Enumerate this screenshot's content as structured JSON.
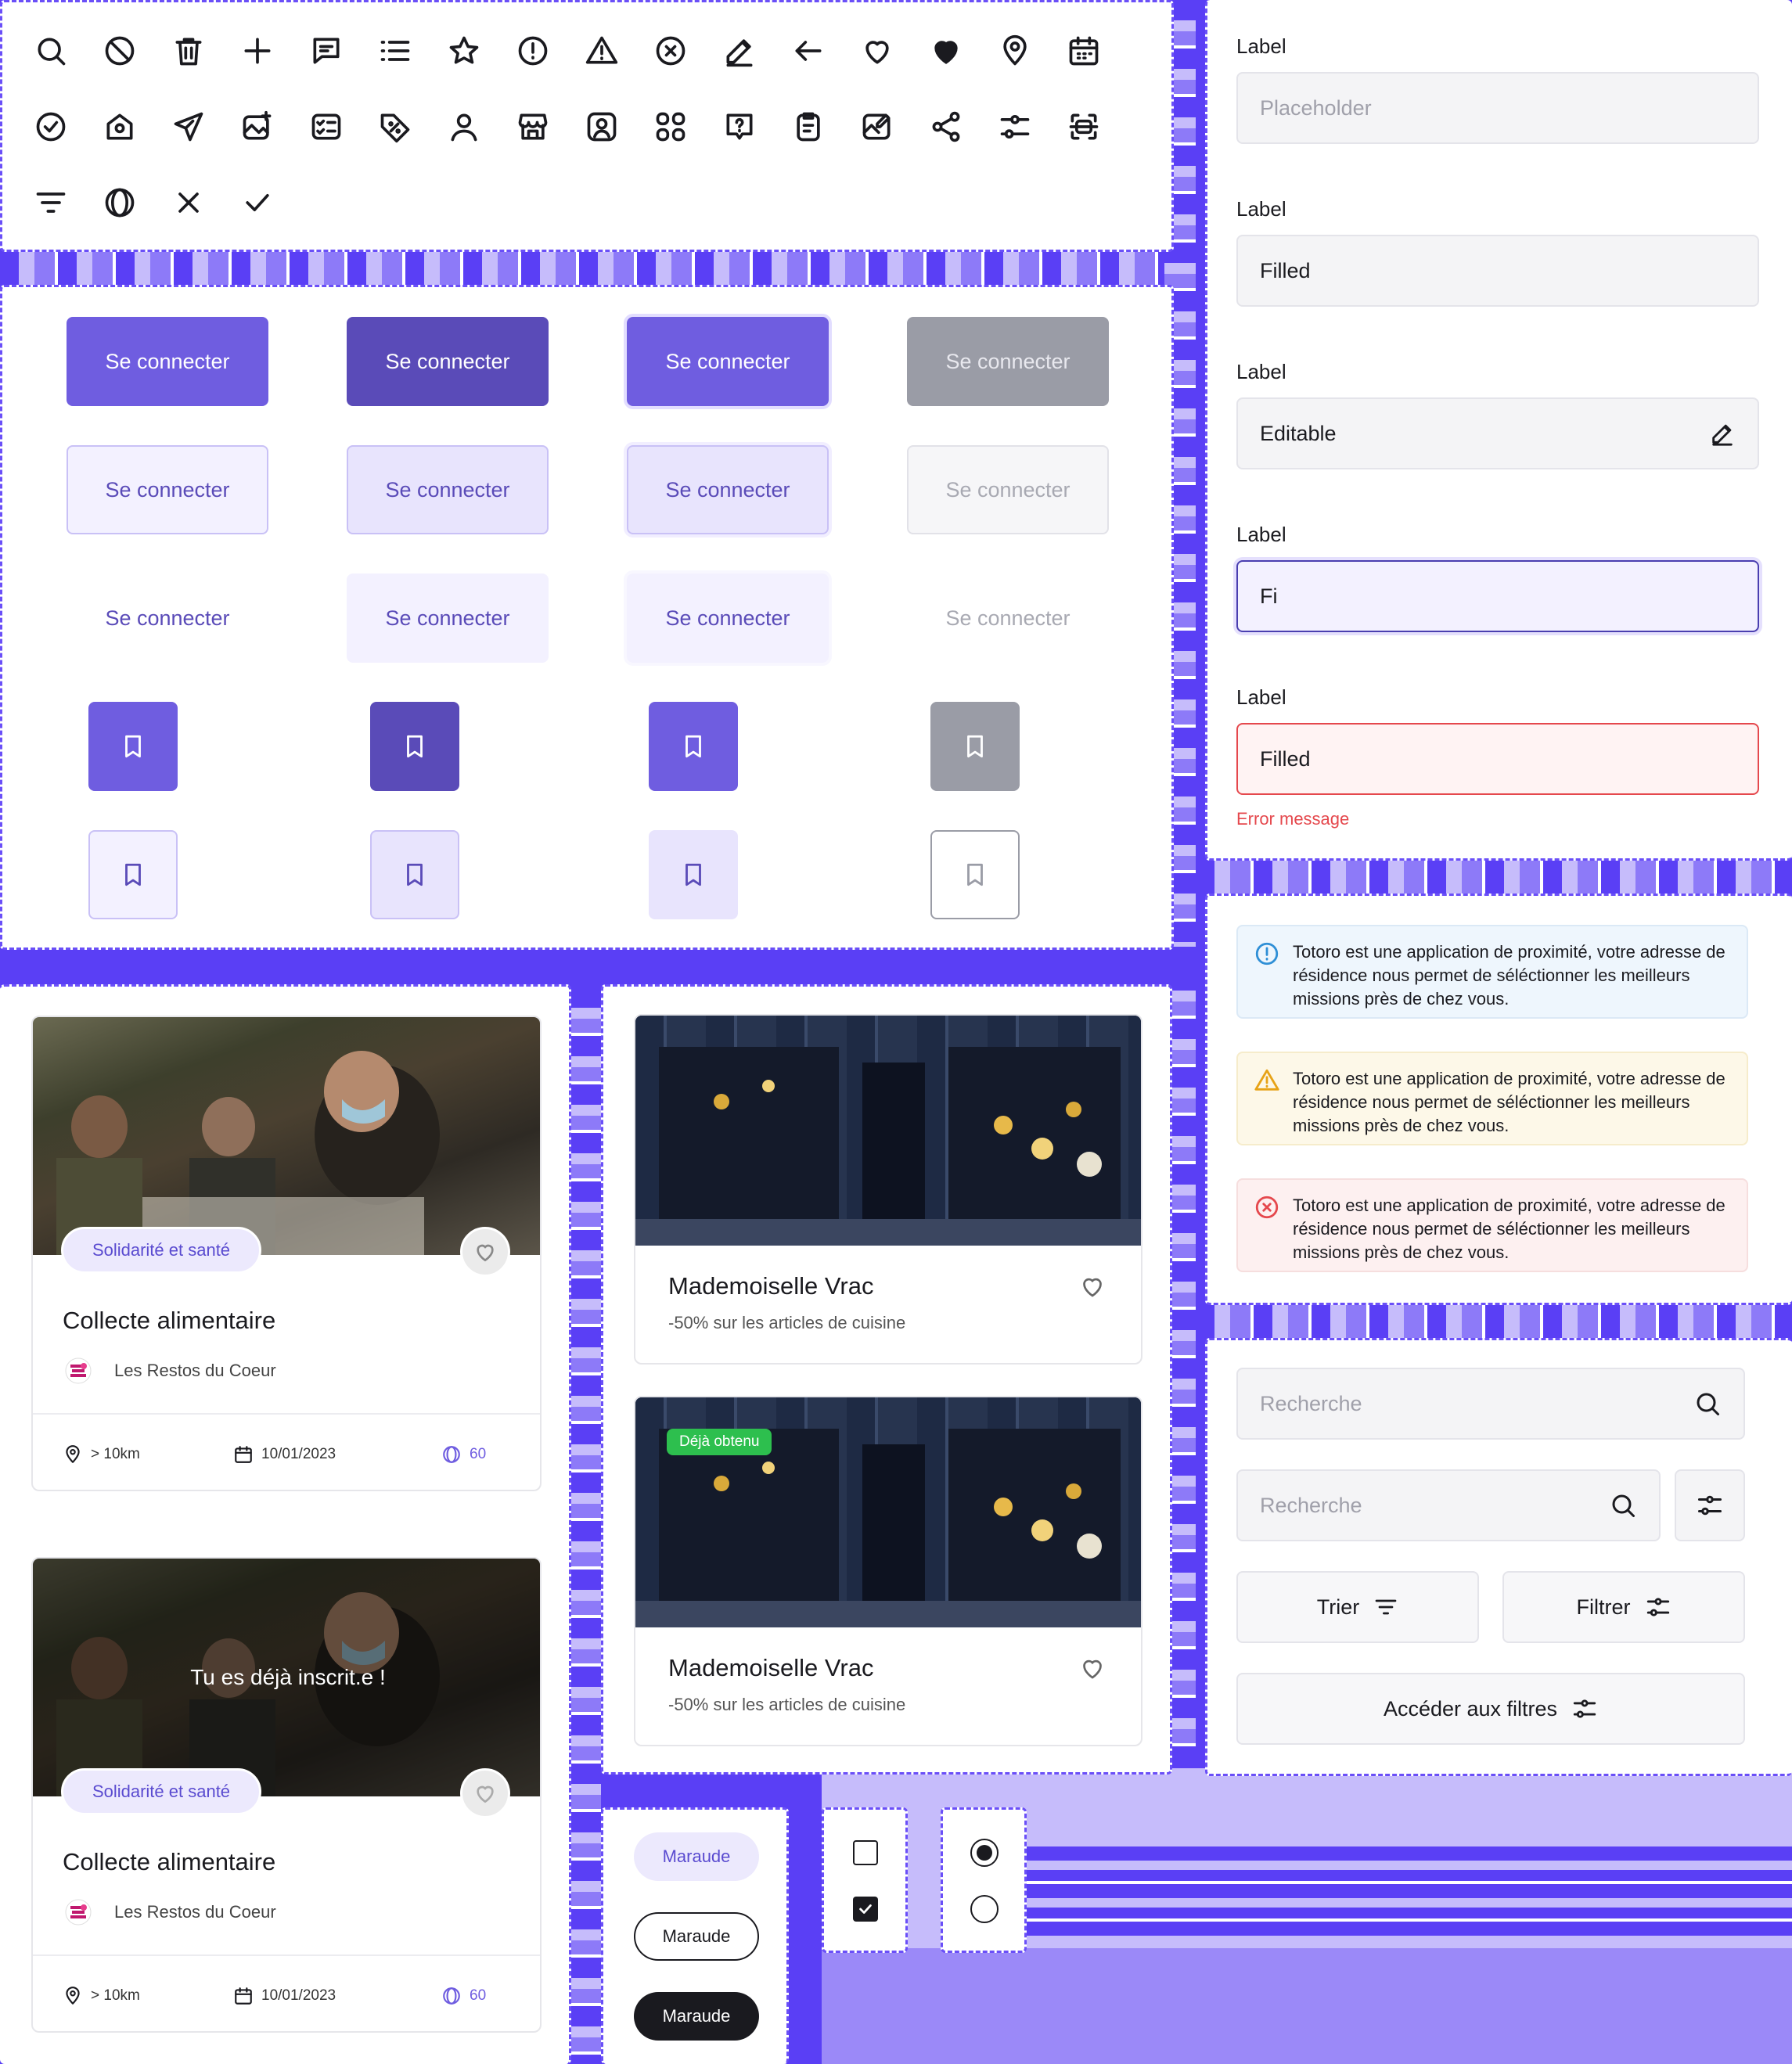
{
  "icons": [
    "search-icon",
    "forbidden-icon",
    "trash-icon",
    "plus-icon",
    "message-icon",
    "list-icon",
    "star-icon",
    "info-circle-icon",
    "warning-triangle-icon",
    "close-circle-icon",
    "pencil-icon",
    "arrow-left-icon",
    "heart-outline-icon",
    "heart-filled-icon",
    "map-pin-icon",
    "calendar-icon",
    "check-circle-icon",
    "home-icon",
    "send-icon",
    "image-add-icon",
    "checklist-icon",
    "discount-tag-icon",
    "user-icon",
    "store-icon",
    "user-square-icon",
    "grid-icon",
    "help-bubble-icon",
    "clipboard-icon",
    "image-edit-icon",
    "share-icon",
    "sliders-icon",
    "scan-icon",
    "filter-lines-icon",
    "coin-icon",
    "x-icon",
    "check-icon"
  ],
  "buttons": {
    "label": "Se connecter"
  },
  "form": {
    "label": "Label",
    "placeholder": "Placeholder",
    "filled": "Filled",
    "editable": "Editable",
    "typing": "Fi",
    "error_value": "Filled",
    "error_message": "Error message"
  },
  "alerts": {
    "text": "Totoro est une application de proximité, votre adresse de résidence nous permet de séléctionner les meilleurs missions près de chez vous."
  },
  "mission_card": {
    "category": "Solidarité et santé",
    "title": "Collecte alimentaire",
    "organization": "Les Restos du Coeur",
    "distance": "> 10km",
    "date": "10/01/2023",
    "points": "60",
    "overlay": "Tu es déjà inscrit.e !"
  },
  "offer_card": {
    "title": "Mademoiselle Vrac",
    "subtitle": "-50% sur les articles de cuisine",
    "badge": "Déjà obtenu"
  },
  "search": {
    "placeholder": "Recherche",
    "sort": "Trier",
    "filter": "Filtrer",
    "access_filters": "Accéder aux filtres"
  },
  "chips": {
    "label": "Maraude"
  },
  "colors": {
    "primary": "#6f5de0",
    "primary_dark": "#5a4bb8",
    "disabled": "#9a9ca6",
    "error": "#e5484d"
  }
}
